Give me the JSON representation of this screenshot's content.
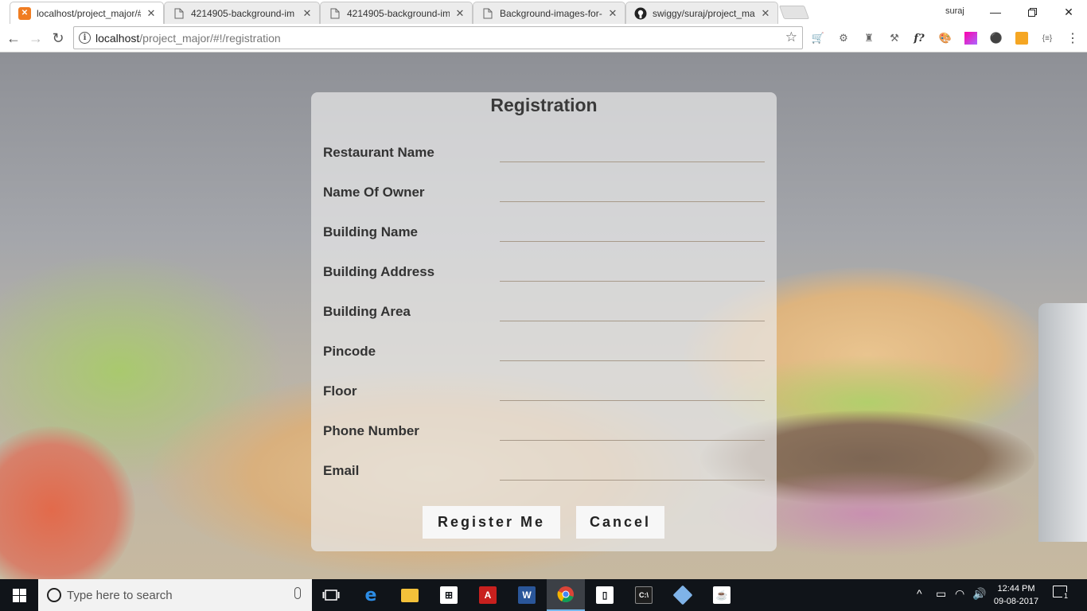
{
  "browser": {
    "tabs": [
      {
        "title": "localhost/project_major/#",
        "favicon": "xampp-icon",
        "active": true
      },
      {
        "title": "4214905-background-im",
        "favicon": "document-icon",
        "active": false
      },
      {
        "title": "4214905-background-im",
        "favicon": "document-icon",
        "active": false
      },
      {
        "title": "Background-images-for-",
        "favicon": "document-icon",
        "active": false
      },
      {
        "title": "swiggy/suraj/project_ma",
        "favicon": "github-icon",
        "active": false
      }
    ],
    "user": "suraj",
    "address": {
      "host": "localhost",
      "path": "/project_major/#!/registration"
    }
  },
  "form": {
    "title": "Registration",
    "fields": [
      {
        "label": "Restaurant Name",
        "value": ""
      },
      {
        "label": "Name Of Owner",
        "value": ""
      },
      {
        "label": "Building Name",
        "value": ""
      },
      {
        "label": "Building Address",
        "value": ""
      },
      {
        "label": "Building Area",
        "value": ""
      },
      {
        "label": "Pincode",
        "value": ""
      },
      {
        "label": "Floor",
        "value": ""
      },
      {
        "label": "Phone Number",
        "value": ""
      },
      {
        "label": "Email",
        "value": ""
      }
    ],
    "register_label": "Register Me",
    "cancel_label": "Cancel"
  },
  "taskbar": {
    "search_placeholder": "Type here to search",
    "time": "12:44 PM",
    "date": "09-08-2017",
    "notification_count": "1"
  },
  "colors": {
    "card_background": "#e8e8e8",
    "taskbar": "#101419",
    "xampp_orange": "#f07d22"
  }
}
